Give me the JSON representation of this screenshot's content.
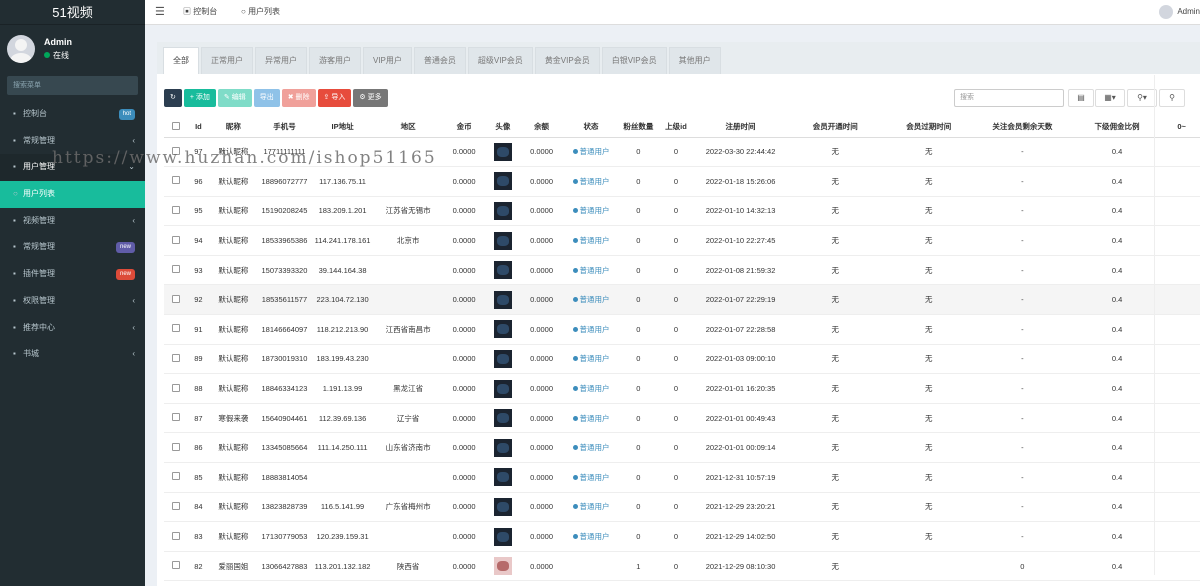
{
  "app": {
    "title": "51视频"
  },
  "user": {
    "name": "Admin",
    "status": "在线"
  },
  "sidebar": {
    "search_placeholder": "搜索菜单",
    "items": [
      {
        "label": "控制台",
        "icon": "dashboard-icon",
        "badge": "hot",
        "badge_color": "#3c8dbc"
      },
      {
        "label": "常规管理",
        "icon": "list-icon",
        "chev": "‹"
      },
      {
        "label": "用户管理",
        "icon": "users-icon",
        "chev": "⌄",
        "open": true
      },
      {
        "label": "用户列表",
        "icon": "circle-icon",
        "active": true
      },
      {
        "label": "视频管理",
        "icon": "video-icon",
        "chev": "‹"
      },
      {
        "label": "常规管理",
        "icon": "cogs-icon",
        "badge": "new",
        "badge_color": "#605ca8"
      },
      {
        "label": "插件管理",
        "icon": "rocket-icon",
        "badge": "new",
        "badge_color": "#dd4b39"
      },
      {
        "label": "权限管理",
        "icon": "group-icon",
        "chev": "‹"
      },
      {
        "label": "推荐中心",
        "icon": "list-icon",
        "chev": "‹"
      },
      {
        "label": "书城",
        "icon": "list-icon",
        "chev": "‹"
      }
    ]
  },
  "topbar": {
    "tab1": "控制台",
    "tab2": "用户列表",
    "user": "Admin"
  },
  "tabs": [
    "全部",
    "正常用户",
    "异常用户",
    "游客用户",
    "VIP用户",
    "普通会员",
    "超级VIP会员",
    "黄金VIP会员",
    "白银VIP会员",
    "其他用户"
  ],
  "toolbar": {
    "refresh": "↻",
    "add": "+ 添加",
    "edit": "✎ 编辑",
    "export": "导出",
    "delete": "✖ 删除",
    "import": "⇪ 导入",
    "more": "⚙ 更多"
  },
  "search_placeholder": "搜索",
  "table": {
    "columns": [
      "Id",
      "昵称",
      "手机号",
      "IP地址",
      "地区",
      "金币",
      "头像",
      "余额",
      "状态",
      "粉丝数量",
      "上级id",
      "注册时间",
      "会员开通时间",
      "会员过期时间",
      "关注会员剩余天数",
      "下级佣金比例",
      "0~"
    ],
    "rows": [
      {
        "id": "97",
        "nick": "默认昵称",
        "phone": "17711111111",
        "ip": "",
        "region": "",
        "coin": "0.0000",
        "money": "0.0000",
        "status": "普通用户",
        "fans": "0",
        "pid": "0",
        "reg": "2022-03-30 22:44:42",
        "vip_open": "无",
        "vip_exp": "无",
        "days": "-",
        "ratio": "0.4",
        "avatar": "dark"
      },
      {
        "id": "96",
        "nick": "默认昵称",
        "phone": "18896072777",
        "ip": "117.136.75.11",
        "region": "",
        "coin": "0.0000",
        "money": "0.0000",
        "status": "普通用户",
        "fans": "0",
        "pid": "0",
        "reg": "2022-01-18 15:26:06",
        "vip_open": "无",
        "vip_exp": "无",
        "days": "-",
        "ratio": "0.4",
        "avatar": "dark"
      },
      {
        "id": "95",
        "nick": "默认昵称",
        "phone": "15190208245",
        "ip": "183.209.1.201",
        "region": "江苏省无锡市",
        "coin": "0.0000",
        "money": "0.0000",
        "status": "普通用户",
        "fans": "0",
        "pid": "0",
        "reg": "2022-01-10 14:32:13",
        "vip_open": "无",
        "vip_exp": "无",
        "days": "-",
        "ratio": "0.4",
        "avatar": "dark"
      },
      {
        "id": "94",
        "nick": "默认昵称",
        "phone": "18533965386",
        "ip": "114.241.178.161",
        "region": "北京市",
        "coin": "0.0000",
        "money": "0.0000",
        "status": "普通用户",
        "fans": "0",
        "pid": "0",
        "reg": "2022-01-10 22:27:45",
        "vip_open": "无",
        "vip_exp": "无",
        "days": "-",
        "ratio": "0.4",
        "avatar": "dark"
      },
      {
        "id": "93",
        "nick": "默认昵称",
        "phone": "15073393320",
        "ip": "39.144.164.38",
        "region": "",
        "coin": "0.0000",
        "money": "0.0000",
        "status": "普通用户",
        "fans": "0",
        "pid": "0",
        "reg": "2022-01-08 21:59:32",
        "vip_open": "无",
        "vip_exp": "无",
        "days": "-",
        "ratio": "0.4",
        "avatar": "dark"
      },
      {
        "id": "92",
        "nick": "默认昵称",
        "phone": "18535611577",
        "ip": "223.104.72.130",
        "region": "",
        "coin": "0.0000",
        "money": "0.0000",
        "status": "普通用户",
        "fans": "0",
        "pid": "0",
        "reg": "2022-01-07 22:29:19",
        "vip_open": "无",
        "vip_exp": "无",
        "days": "-",
        "ratio": "0.4",
        "avatar": "dark"
      },
      {
        "id": "91",
        "nick": "默认昵称",
        "phone": "18146664097",
        "ip": "118.212.213.90",
        "region": "江西省南昌市",
        "coin": "0.0000",
        "money": "0.0000",
        "status": "普通用户",
        "fans": "0",
        "pid": "0",
        "reg": "2022-01-07 22:28:58",
        "vip_open": "无",
        "vip_exp": "无",
        "days": "-",
        "ratio": "0.4",
        "avatar": "dark"
      },
      {
        "id": "89",
        "nick": "默认昵称",
        "phone": "18730019310",
        "ip": "183.199.43.230",
        "region": "",
        "coin": "0.0000",
        "money": "0.0000",
        "status": "普通用户",
        "fans": "0",
        "pid": "0",
        "reg": "2022-01-03 09:00:10",
        "vip_open": "无",
        "vip_exp": "无",
        "days": "-",
        "ratio": "0.4",
        "avatar": "dark"
      },
      {
        "id": "88",
        "nick": "默认昵称",
        "phone": "18846334123",
        "ip": "1.191.13.99",
        "region": "黑龙江省",
        "coin": "0.0000",
        "money": "0.0000",
        "status": "普通用户",
        "fans": "0",
        "pid": "0",
        "reg": "2022-01-01 16:20:35",
        "vip_open": "无",
        "vip_exp": "无",
        "days": "-",
        "ratio": "0.4",
        "avatar": "dark"
      },
      {
        "id": "87",
        "nick": "寒假来袭",
        "phone": "15640904461",
        "ip": "112.39.69.136",
        "region": "辽宁省",
        "coin": "0.0000",
        "money": "0.0000",
        "status": "普通用户",
        "fans": "0",
        "pid": "0",
        "reg": "2022-01-01 00:49:43",
        "vip_open": "无",
        "vip_exp": "无",
        "days": "-",
        "ratio": "0.4",
        "avatar": "dark"
      },
      {
        "id": "86",
        "nick": "默认昵称",
        "phone": "13345085664",
        "ip": "111.14.250.111",
        "region": "山东省济南市",
        "coin": "0.0000",
        "money": "0.0000",
        "status": "普通用户",
        "fans": "0",
        "pid": "0",
        "reg": "2022-01-01 00:09:14",
        "vip_open": "无",
        "vip_exp": "无",
        "days": "-",
        "ratio": "0.4",
        "avatar": "dark"
      },
      {
        "id": "85",
        "nick": "默认昵称",
        "phone": "18883814054",
        "ip": "",
        "region": "",
        "coin": "0.0000",
        "money": "0.0000",
        "status": "普通用户",
        "fans": "0",
        "pid": "0",
        "reg": "2021-12-31 10:57:19",
        "vip_open": "无",
        "vip_exp": "无",
        "days": "-",
        "ratio": "0.4",
        "avatar": "dark"
      },
      {
        "id": "84",
        "nick": "默认昵称",
        "phone": "13823828739",
        "ip": "116.5.141.99",
        "region": "广东省梅州市",
        "coin": "0.0000",
        "money": "0.0000",
        "status": "普通用户",
        "fans": "0",
        "pid": "0",
        "reg": "2021-12-29 23:20:21",
        "vip_open": "无",
        "vip_exp": "无",
        "days": "-",
        "ratio": "0.4",
        "avatar": "dark"
      },
      {
        "id": "83",
        "nick": "默认昵称",
        "phone": "17130779053",
        "ip": "120.239.159.31",
        "region": "",
        "coin": "0.0000",
        "money": "0.0000",
        "status": "普通用户",
        "fans": "0",
        "pid": "0",
        "reg": "2021-12-29 14:02:50",
        "vip_open": "无",
        "vip_exp": "无",
        "days": "-",
        "ratio": "0.4",
        "avatar": "dark"
      },
      {
        "id": "82",
        "nick": "爱丽国姐",
        "phone": "13066427883",
        "ip": "113.201.132.182",
        "region": "陕西省",
        "coin": "0.0000",
        "money": "0.0000",
        "status": "",
        "fans": "1",
        "pid": "0",
        "reg": "2021-12-29 08:10:30",
        "vip_open": "无",
        "vip_exp": "",
        "days": "0",
        "ratio": "0.4",
        "avatar": "pink"
      }
    ]
  },
  "watermark": "https://www.huzhan.com/ishop51165"
}
